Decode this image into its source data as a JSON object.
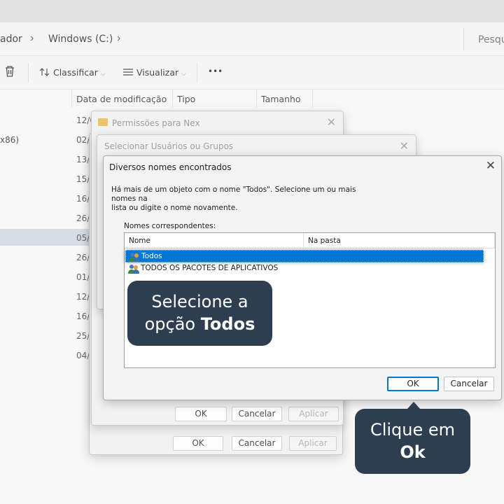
{
  "explorer": {
    "breadcrumbs": [
      "ador",
      "Windows (C:)"
    ],
    "search_placeholder": "Pesqu",
    "toolbar": {
      "sort_label": "Classificar",
      "view_label": "Visualizar",
      "more_label": "•••"
    },
    "columns": [
      "Data de modificação",
      "Tipo",
      "Tamanho"
    ],
    "name_fragment": "x86)",
    "dates": [
      "12/0",
      "02/0",
      "13/0",
      "15/0",
      "16/0",
      "26/0",
      "05/0",
      "26/0",
      "01/0",
      "12/0",
      "16/0",
      "25/0",
      "04/0"
    ]
  },
  "dialog_permissions": {
    "title": "Permissões para Nex",
    "ok_label": "OK",
    "cancel_label": "Cancelar",
    "apply_label": "Aplicar"
  },
  "dialog_select": {
    "title": "Selecionar Usuários ou Grupos",
    "ok_label": "OK",
    "cancel_label": "Cancelar",
    "apply_label": "Aplicar"
  },
  "dialog_main": {
    "title": "Diversos nomes encontrados",
    "close_glyph": "✕",
    "message_line1": "Há mais de um objeto com o nome \"Todos\". Selecione um ou mais nomes na",
    "message_line2": "lista ou digite o nome novamente.",
    "list_label": "Nomes correspondentes:",
    "list_columns": [
      "Nome",
      "Na pasta"
    ],
    "rows": [
      {
        "name": "Todos",
        "folder": "",
        "selected": true
      },
      {
        "name": "TODOS OS PACOTES DE APLICATIVOS",
        "folder": "",
        "selected": false
      }
    ],
    "ok_label": "OK",
    "cancel_label": "Cancelar"
  },
  "callouts": {
    "c1_line1": "Selecione a",
    "c1_line2_plain": "opção ",
    "c1_line2_bold": "Todos",
    "c2_line1": "Clique em",
    "c2_line2_bold": "Ok"
  },
  "colors": {
    "accent": "#0078d7",
    "callout_bg": "#2c3e50"
  }
}
